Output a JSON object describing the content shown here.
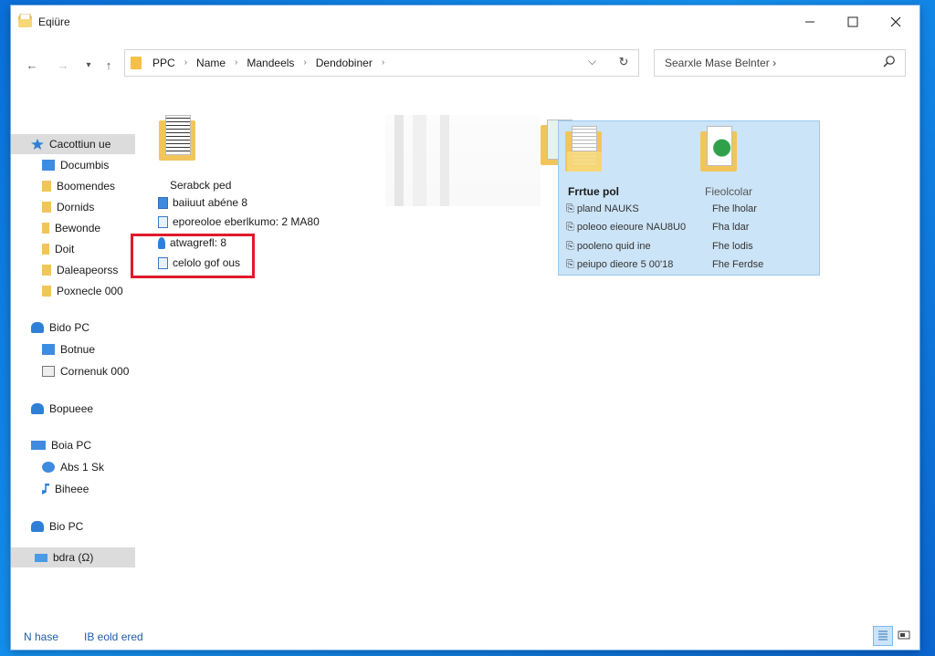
{
  "window": {
    "title": "Eqiüre"
  },
  "toolbar": {
    "back": "←",
    "forward": "→",
    "recent": "▾",
    "up": "↑",
    "breadcrumb": [
      "PPC",
      "Name",
      "Mandeels",
      "Dendobiner"
    ],
    "breadcrumb_sep": "›",
    "dropdown": "⌵",
    "refresh": "↻",
    "search_placeholder": "Searxle  Mase Belnter",
    "search_chevron": "›"
  },
  "sidebar": {
    "quick_access": {
      "label": "Cacottiun ue"
    },
    "quick_items": [
      "Documbis",
      "Boomendes",
      "Dornids",
      "Bewonde",
      "Doit",
      "Daleapeorss",
      "Poxnecle 000"
    ],
    "this_pc_1": {
      "label": "Bido PC",
      "items": [
        "Botnue",
        "Cornenuk 000"
      ]
    },
    "network": {
      "label": "Bopueee"
    },
    "this_pc_2": {
      "label": "Boia PC",
      "items": [
        "Abs 1 Sk",
        "Biheee"
      ]
    },
    "this_pc_3": {
      "label": "Bio PC"
    },
    "drive": {
      "label": "bdra (Ω)"
    }
  },
  "content": {
    "left_folder": {
      "name": "Serabck ped",
      "files": [
        "baiiuut abéne 8",
        "eporeoloe eberlkumo: 2 MA80",
        "atwagrefl: 8",
        "celolo gof ous"
      ]
    },
    "selected_group": {
      "col1_header": "Frrtue pol",
      "col2_header": "Fieolcolar",
      "rows": [
        {
          "name": "pland NAUKS",
          "type": "Fhe lholar"
        },
        {
          "name": "poleoo eieoure NAU8U0",
          "type": "Fha ldar"
        },
        {
          "name": "pooleno quid ine",
          "type": "Fhe lodis"
        },
        {
          "name": "peiupo dieore 5 00'18",
          "type": "Fhe Ferdse"
        }
      ]
    }
  },
  "statusbar": {
    "items": "N hase",
    "selected": "IB eold ered"
  },
  "colors": {
    "accent": "#0a78d7",
    "highlight": "#e0192b",
    "selection": "#cce4f7",
    "folder": "#f2c55c"
  }
}
